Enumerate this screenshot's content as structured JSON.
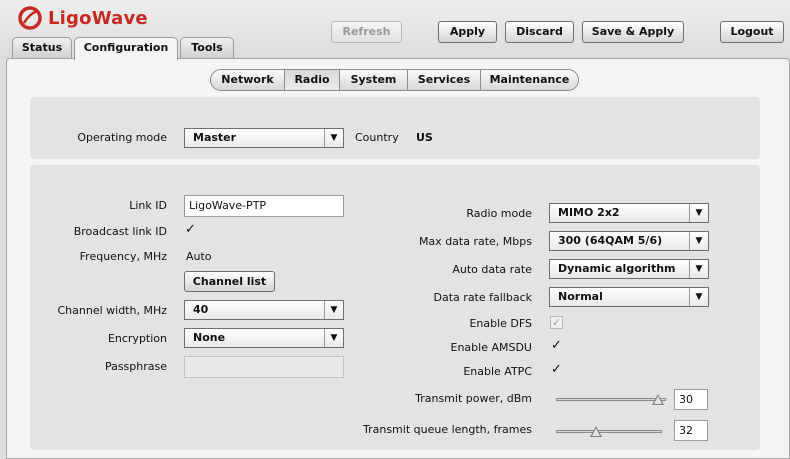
{
  "app": {
    "logo_text": "LigoWave"
  },
  "main_tabs": [
    {
      "label": "Status"
    },
    {
      "label": "Configuration"
    },
    {
      "label": "Tools"
    }
  ],
  "toolbar": {
    "refresh_label": "Refresh",
    "apply_label": "Apply",
    "discard_label": "Discard",
    "save_apply_label": "Save & Apply",
    "logout_label": "Logout"
  },
  "sub_tabs": [
    {
      "label": "Network"
    },
    {
      "label": "Radio"
    },
    {
      "label": "System"
    },
    {
      "label": "Services"
    },
    {
      "label": "Maintenance"
    }
  ],
  "general": {
    "operating_mode_label": "Operating mode",
    "operating_mode_value": "Master",
    "country_label": "Country",
    "country_value": "US"
  },
  "left": {
    "link_id_label": "Link ID",
    "link_id_value": "LigoWave-PTP",
    "broadcast_label": "Broadcast link ID",
    "broadcast_checked": true,
    "frequency_label": "Frequency, MHz",
    "frequency_value": "Auto",
    "channel_list_label": "Channel list",
    "channel_width_label": "Channel width, MHz",
    "channel_width_value": "40",
    "encryption_label": "Encryption",
    "encryption_value": "None",
    "passphrase_label": "Passphrase",
    "passphrase_value": ""
  },
  "right": {
    "radio_mode_label": "Radio mode",
    "radio_mode_value": "MIMO 2x2",
    "max_rate_label": "Max data rate, Mbps",
    "max_rate_value": "300 (64QAM 5/6)",
    "auto_rate_label": "Auto data rate",
    "auto_rate_value": "Dynamic algorithm",
    "fallback_label": "Data rate fallback",
    "fallback_value": "Normal",
    "dfs_label": "Enable DFS",
    "dfs_checked": true,
    "amsdu_label": "Enable AMSDU",
    "amsdu_checked": true,
    "atpc_label": "Enable ATPC",
    "atpc_checked": true,
    "tx_power_label": "Transmit power, dBm",
    "tx_power_value": "30",
    "tx_power_fraction": 0.93,
    "queue_label": "Transmit queue length, frames",
    "queue_value": "32",
    "queue_fraction": 0.38
  },
  "colors": {
    "brand": "#c62a24",
    "background": "#e0e0e0",
    "panel": "#e3e3e3"
  },
  "icons": {
    "logo": "ligowave-logo-icon",
    "dropdown": "chevron-down-icon",
    "check": "checkmark-icon",
    "slider": "slider-thumb-icon"
  }
}
